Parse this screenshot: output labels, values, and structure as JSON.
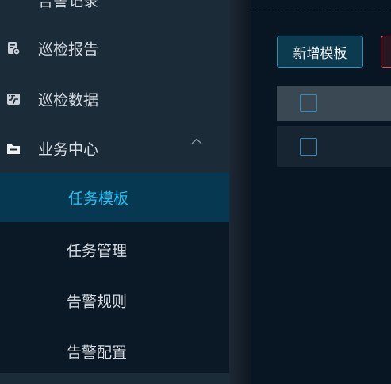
{
  "sidebar": {
    "items": [
      {
        "label": "告警记录",
        "icon": "alarm-record-icon"
      },
      {
        "label": "巡检报告",
        "icon": "inspection-report-icon"
      },
      {
        "label": "巡检数据",
        "icon": "inspection-data-icon"
      },
      {
        "label": "业务中心",
        "icon": "business-center-icon",
        "expanded": true
      }
    ],
    "submenu": [
      {
        "label": "任务模板",
        "active": true
      },
      {
        "label": "任务管理"
      },
      {
        "label": "告警规则"
      },
      {
        "label": "告警配置"
      }
    ]
  },
  "toolbar": {
    "add_template_label": "新增模板"
  },
  "colors": {
    "sidebar_bg": "#1c2b38",
    "active_item_bg": "#063852",
    "active_text": "#1ec3f4",
    "accent_border": "#3a8db0",
    "danger_border": "#d4505f"
  }
}
